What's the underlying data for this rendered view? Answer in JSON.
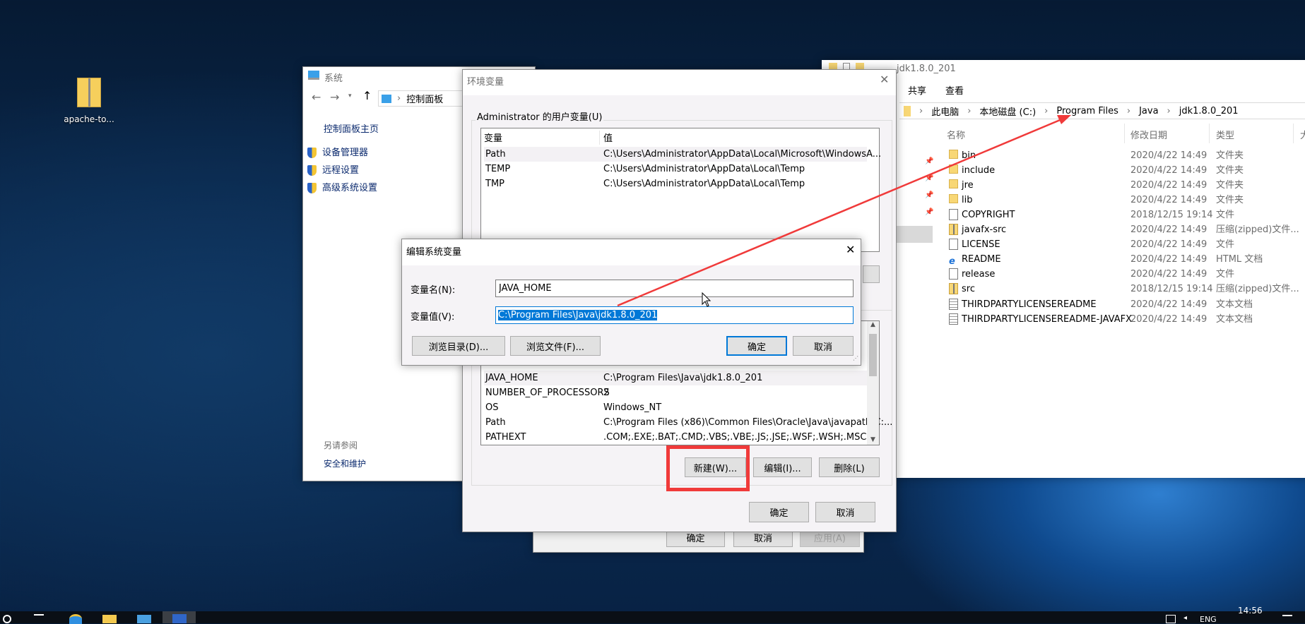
{
  "desktop": {
    "icons": [
      {
        "label": "apache-to...",
        "icon": "zip-folder-icon"
      }
    ]
  },
  "system_window": {
    "title": "系统",
    "breadcrumb": [
      "控制面板"
    ],
    "home_link": "控制面板主页",
    "links": [
      "设备管理器",
      "远程设置",
      "高级系统设置"
    ],
    "see_also": "另请参阅",
    "see_also_links": [
      "安全和维护"
    ]
  },
  "system_properties": {
    "buttons": {
      "ok": "确定",
      "cancel": "取消",
      "apply": "应用(A)"
    }
  },
  "env_dialog": {
    "title": "环境变量",
    "user_group": "Administrator 的用户变量(U)",
    "columns": [
      "变量",
      "值"
    ],
    "user_vars": [
      {
        "name": "Path",
        "value": "C:\\Users\\Administrator\\AppData\\Local\\Microsoft\\WindowsA..."
      },
      {
        "name": "TEMP",
        "value": "C:\\Users\\Administrator\\AppData\\Local\\Temp"
      },
      {
        "name": "TMP",
        "value": "C:\\Users\\Administrator\\AppData\\Local\\Temp"
      }
    ],
    "system_vars": [
      {
        "name": "JAVA_HOME",
        "value": "C:\\Program Files\\Java\\jdk1.8.0_201"
      },
      {
        "name": "NUMBER_OF_PROCESSORS",
        "value": "2"
      },
      {
        "name": "OS",
        "value": "Windows_NT"
      },
      {
        "name": "Path",
        "value": "C:\\Program Files (x86)\\Common Files\\Oracle\\Java\\javapath;C:..."
      },
      {
        "name": "PATHEXT",
        "value": ".COM;.EXE;.BAT;.CMD;.VBS;.VBE;.JS;.JSE;.WSF;.WSH;.MSC"
      }
    ],
    "buttons": {
      "new": "新建(W)...",
      "edit": "编辑(I)...",
      "delete": "删除(L)",
      "ok": "确定",
      "cancel": "取消"
    },
    "highlight_color": "#f03a3a"
  },
  "edit_dialog": {
    "title": "编辑系统变量",
    "name_label": "变量名(N):",
    "name_value": "JAVA_HOME",
    "value_label": "变量值(V):",
    "value_value": "C:\\Program Files\\Java\\jdk1.8.0_201",
    "buttons": {
      "browse_dir": "浏览目录(D)...",
      "browse_file": "浏览文件(F)...",
      "ok": "确定",
      "cancel": "取消"
    },
    "selection_color": "#0078d7"
  },
  "explorer": {
    "title": "jdk1.8.0_201",
    "ribbon_tabs": [
      "共享",
      "查看"
    ],
    "breadcrumb": [
      "此电脑",
      "本地磁盘 (C:)",
      "Program Files",
      "Java",
      "jdk1.8.0_201"
    ],
    "columns": [
      "名称",
      "修改日期",
      "类型",
      "大"
    ],
    "files": [
      {
        "name": "bin",
        "date": "2020/4/22 14:49",
        "type": "文件夹",
        "icon": "folder"
      },
      {
        "name": "include",
        "date": "2020/4/22 14:49",
        "type": "文件夹",
        "icon": "folder"
      },
      {
        "name": "jre",
        "date": "2020/4/22 14:49",
        "type": "文件夹",
        "icon": "folder"
      },
      {
        "name": "lib",
        "date": "2020/4/22 14:49",
        "type": "文件夹",
        "icon": "folder"
      },
      {
        "name": "COPYRIGHT",
        "date": "2018/12/15 19:14",
        "type": "文件",
        "icon": "file"
      },
      {
        "name": "javafx-src",
        "date": "2020/4/22 14:49",
        "type": "压缩(zipped)文件...",
        "icon": "zip"
      },
      {
        "name": "LICENSE",
        "date": "2020/4/22 14:49",
        "type": "文件",
        "icon": "file"
      },
      {
        "name": "README",
        "date": "2020/4/22 14:49",
        "type": "HTML 文档",
        "icon": "html"
      },
      {
        "name": "release",
        "date": "2020/4/22 14:49",
        "type": "文件",
        "icon": "file"
      },
      {
        "name": "src",
        "date": "2018/12/15 19:14",
        "type": "压缩(zipped)文件...",
        "icon": "zip"
      },
      {
        "name": "THIRDPARTYLICENSEREADME",
        "date": "2020/4/22 14:49",
        "type": "文本文档",
        "icon": "txt"
      },
      {
        "name": "THIRDPARTYLICENSEREADME-JAVAFX",
        "date": "2020/4/22 14:49",
        "type": "文本文档",
        "icon": "txt"
      }
    ]
  },
  "taskbar": {
    "clock": "14:56",
    "lang": "ENG"
  }
}
